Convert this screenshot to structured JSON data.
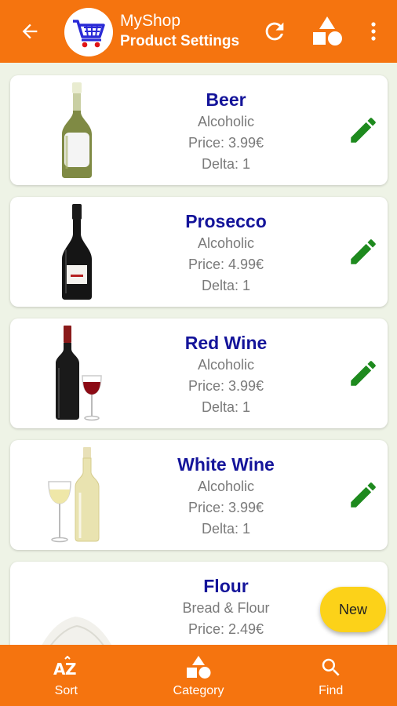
{
  "appbar": {
    "app_name": "MyShop",
    "screen_title": "Product Settings",
    "icons": [
      "back-arrow-icon",
      "shopping-cart-icon",
      "refresh-icon",
      "shapes-icon",
      "more-vert-icon"
    ]
  },
  "products": [
    {
      "name": "Beer",
      "category": "Alcoholic",
      "price": "Price: 3.99€",
      "delta": "Delta: 1",
      "image": "beer-bottle"
    },
    {
      "name": "Prosecco",
      "category": "Alcoholic",
      "price": "Price: 4.99€",
      "delta": "Delta: 1",
      "image": "prosecco-bottle"
    },
    {
      "name": "Red Wine",
      "category": "Alcoholic",
      "price": "Price: 3.99€",
      "delta": "Delta: 1",
      "image": "red-wine"
    },
    {
      "name": "White Wine",
      "category": "Alcoholic",
      "price": "Price: 3.99€",
      "delta": "Delta: 1",
      "image": "white-wine"
    },
    {
      "name": "Flour",
      "category": "Bread & Flour",
      "price": "Price: 2.49€",
      "delta": "",
      "image": "flour-pile"
    }
  ],
  "fab": {
    "label": "New"
  },
  "bottom_nav": [
    {
      "label": "Sort",
      "icon": "sort-az-icon"
    },
    {
      "label": "Category",
      "icon": "category-shapes-icon"
    },
    {
      "label": "Find",
      "icon": "search-icon"
    }
  ],
  "colors": {
    "primary": "#f5740f",
    "fab": "#fcd219",
    "product_name": "#14149a",
    "edit_icon": "#1e8a1e",
    "background": "#eef3e6"
  }
}
